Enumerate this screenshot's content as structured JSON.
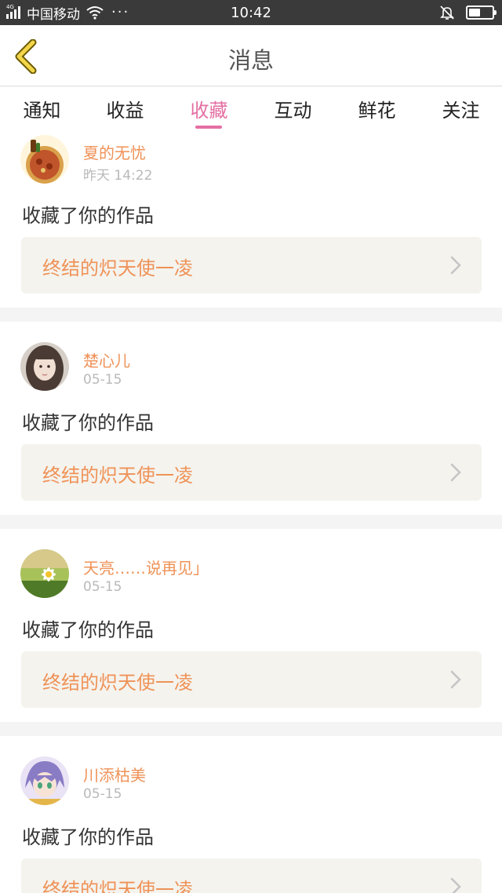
{
  "status_bar": {
    "network": "4G",
    "carrier": "中国移动",
    "more": "···",
    "time": "10:42",
    "battery_level": 0.5
  },
  "header": {
    "back_icon": "chevron-left-icon",
    "title": "消息"
  },
  "tabs": [
    {
      "label": "通知",
      "active": false
    },
    {
      "label": "收益",
      "active": false
    },
    {
      "label": "收藏",
      "active": true
    },
    {
      "label": "互动",
      "active": false
    },
    {
      "label": "鲜花",
      "active": false
    },
    {
      "label": "关注",
      "active": false
    }
  ],
  "colors": {
    "accent": "#e46fa3",
    "name": "#ef9257",
    "work_bg": "#f4f3ee"
  },
  "messages": [
    {
      "user": "夏的无忧",
      "time": "昨天 14:22",
      "action": "收藏了你的作品",
      "work": "终结的炽天使一凌"
    },
    {
      "user": "楚心儿",
      "time": "05-15",
      "action": "收藏了你的作品",
      "work": "终结的炽天使一凌"
    },
    {
      "user": "天亮……说再见」",
      "time": "05-15",
      "action": "收藏了你的作品",
      "work": "终结的炽天使一凌"
    },
    {
      "user": "川添枯美",
      "time": "05-15",
      "action": "收藏了你的作品",
      "work": "终结的炽天使一凌"
    }
  ]
}
